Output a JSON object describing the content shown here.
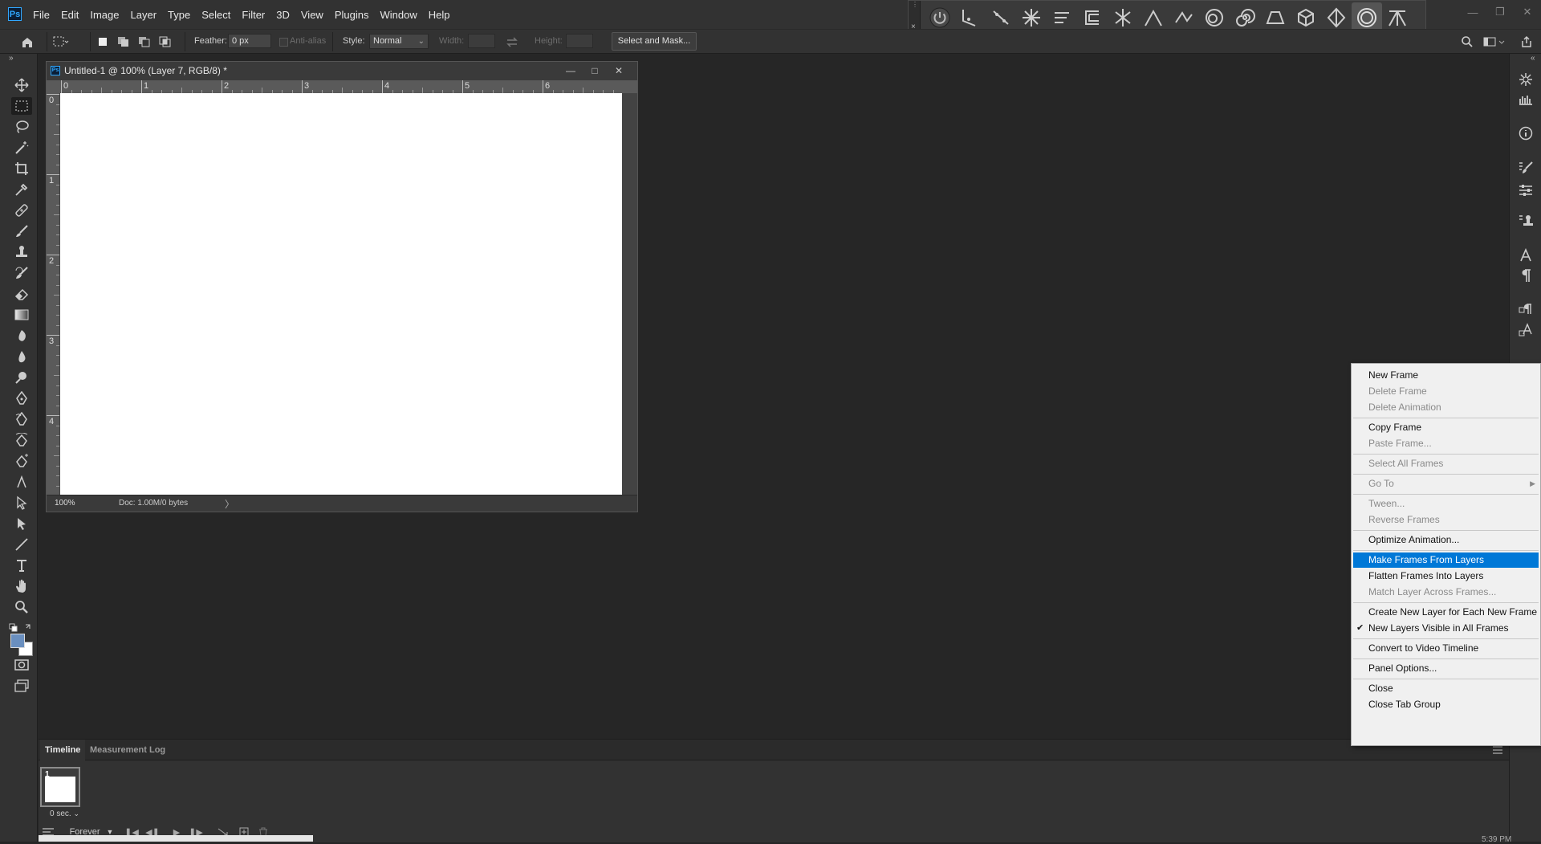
{
  "app": {
    "logo_text": "Ps",
    "menu": [
      "File",
      "Edit",
      "Image",
      "Layer",
      "Type",
      "Select",
      "Filter",
      "3D",
      "View",
      "Plugins",
      "Window",
      "Help"
    ]
  },
  "options_bar": {
    "feather_label": "Feather:",
    "feather_value": "0 px",
    "antialias_label": "Anti-alias",
    "style_label": "Style:",
    "style_value": "Normal",
    "width_label": "Width:",
    "height_label": "Height:",
    "select_mask_label": "Select and Mask..."
  },
  "document": {
    "title": "Untitled-1 @ 100% (Layer 7, RGB/8) *",
    "zoom": "100%",
    "doc_info": "Doc: 1.00M/0 bytes",
    "ruler_h": [
      "0",
      "1",
      "2",
      "3",
      "4",
      "5",
      "6"
    ],
    "ruler_v": [
      "0",
      "1",
      "2",
      "3",
      "4"
    ]
  },
  "timeline": {
    "tabs": [
      "Timeline",
      "Measurement Log"
    ],
    "frame_number": "1",
    "frame_delay": "0 sec.",
    "loop_value": "Forever"
  },
  "taskbar_time": "5:39 PM",
  "context_menu": {
    "items": [
      {
        "label": "New Frame",
        "disabled": false
      },
      {
        "label": "Delete Frame",
        "disabled": true
      },
      {
        "label": "Delete Animation",
        "disabled": true
      },
      {
        "sep": true
      },
      {
        "label": "Copy Frame",
        "disabled": false
      },
      {
        "label": "Paste Frame...",
        "disabled": true
      },
      {
        "sep": true
      },
      {
        "label": "Select All Frames",
        "disabled": true
      },
      {
        "sep": true
      },
      {
        "label": "Go To",
        "disabled": true,
        "submenu": true
      },
      {
        "sep": true
      },
      {
        "label": "Tween...",
        "disabled": true
      },
      {
        "label": "Reverse Frames",
        "disabled": true
      },
      {
        "sep": true
      },
      {
        "label": "Optimize Animation...",
        "disabled": false
      },
      {
        "sep": true
      },
      {
        "label": "Make Frames From Layers",
        "disabled": false,
        "highlight": true
      },
      {
        "label": "Flatten Frames Into Layers",
        "disabled": false
      },
      {
        "label": "Match Layer Across Frames...",
        "disabled": true
      },
      {
        "sep": true
      },
      {
        "label": "Create New Layer for Each New Frame",
        "disabled": false
      },
      {
        "label": "New Layers Visible in All Frames",
        "disabled": false,
        "checked": true
      },
      {
        "sep": true
      },
      {
        "label": "Convert to Video Timeline",
        "disabled": false
      },
      {
        "sep": true
      },
      {
        "label": "Panel Options...",
        "disabled": false
      },
      {
        "sep": true
      },
      {
        "label": "Close",
        "disabled": false
      },
      {
        "label": "Close Tab Group",
        "disabled": false
      }
    ]
  },
  "colors": {
    "accent_blue": "#0078d7",
    "ps_blue": "#31a8ff",
    "foreground_swatch": "#6a8fbf",
    "background_swatch": "#ffffff"
  }
}
